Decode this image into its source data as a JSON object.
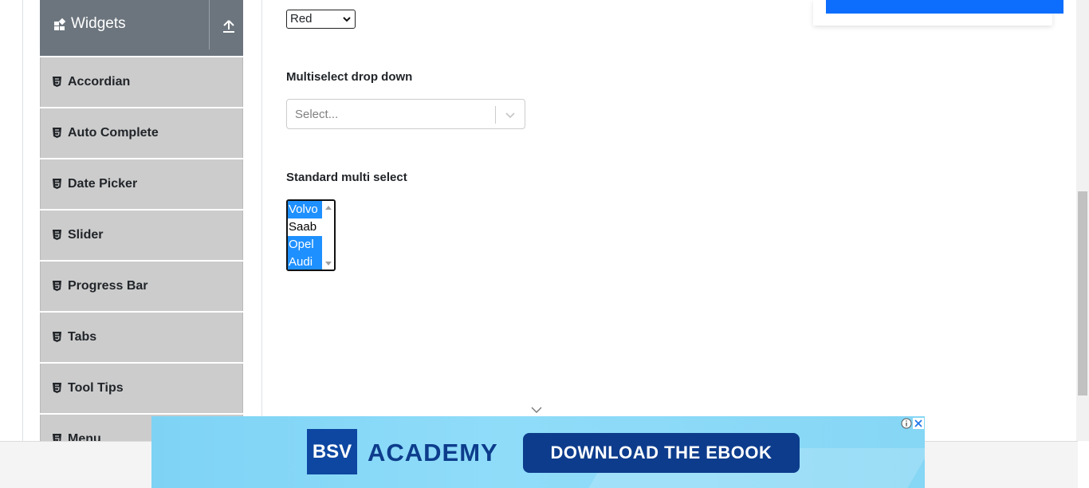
{
  "sidebar": {
    "group_title": "Widgets",
    "items": [
      {
        "label": "Accordian"
      },
      {
        "label": "Auto Complete"
      },
      {
        "label": "Date Picker"
      },
      {
        "label": "Slider"
      },
      {
        "label": "Progress Bar"
      },
      {
        "label": "Tabs"
      },
      {
        "label": "Tool Tips"
      },
      {
        "label": "Menu"
      }
    ]
  },
  "main": {
    "color_select": {
      "value": "Red"
    },
    "multiselect": {
      "label": "Multiselect drop down",
      "placeholder": "Select..."
    },
    "standard_multi": {
      "label": "Standard multi select",
      "options": [
        {
          "label": "Volvo",
          "selected": true
        },
        {
          "label": "Saab",
          "selected": false
        },
        {
          "label": "Opel",
          "selected": true
        },
        {
          "label": "Audi",
          "selected": true
        }
      ]
    }
  },
  "ad": {
    "logo_text": "BSV",
    "brand": "ACADEMY",
    "cta": "DOWNLOAD THE EBOOK"
  },
  "colors": {
    "sidebar_header": "#6c757d",
    "sidebar_item": "#cccccc",
    "selected_option": "#1e90ff",
    "ad_background": "#86d6f5",
    "ad_dark": "#0d3c8c"
  }
}
